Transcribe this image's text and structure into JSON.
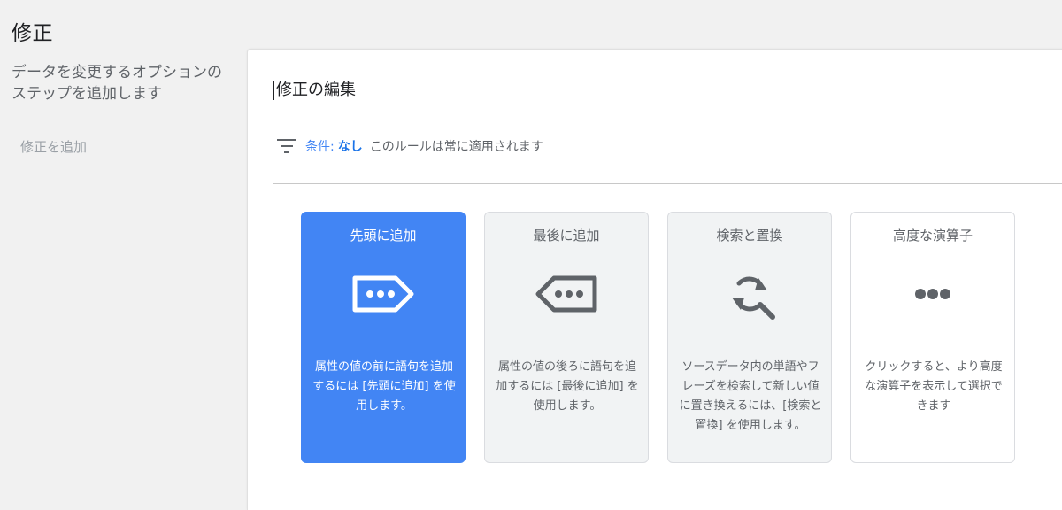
{
  "page": {
    "title": "修正"
  },
  "sidebar": {
    "description": "データを変更するオプションのステップを追加します",
    "add_label": "修正を追加"
  },
  "editor": {
    "title": "修正の編集",
    "condition": {
      "label": "条件:",
      "value": "なし",
      "description": "このルールは常に適用されます"
    }
  },
  "cards": [
    {
      "title": "先頭に追加",
      "icon": "tag-right-dots-icon",
      "description": "属性の値の前に語句を追加するには [先頭に追加] を使用します。",
      "selected": true
    },
    {
      "title": "最後に追加",
      "icon": "tag-left-dots-icon",
      "description": "属性の値の後ろに語句を追加するには [最後に追加] を使用します。",
      "selected": false
    },
    {
      "title": "検索と置換",
      "icon": "find-replace-icon",
      "description": "ソースデータ内の単語やフレーズを検索して新しい値に置き換えるには、[検索と置換] を使用します。",
      "selected": false
    },
    {
      "title": "高度な演算子",
      "icon": "more-horiz-icon",
      "description": "クリックすると、より高度な演算子を表示して選択できます",
      "selected": false
    }
  ],
  "colors": {
    "accent": "#4285f4",
    "link": "#1a73e8",
    "icon_gray": "#5f6368",
    "background": "#f1f1f1",
    "card_bg": "#f1f3f4"
  }
}
